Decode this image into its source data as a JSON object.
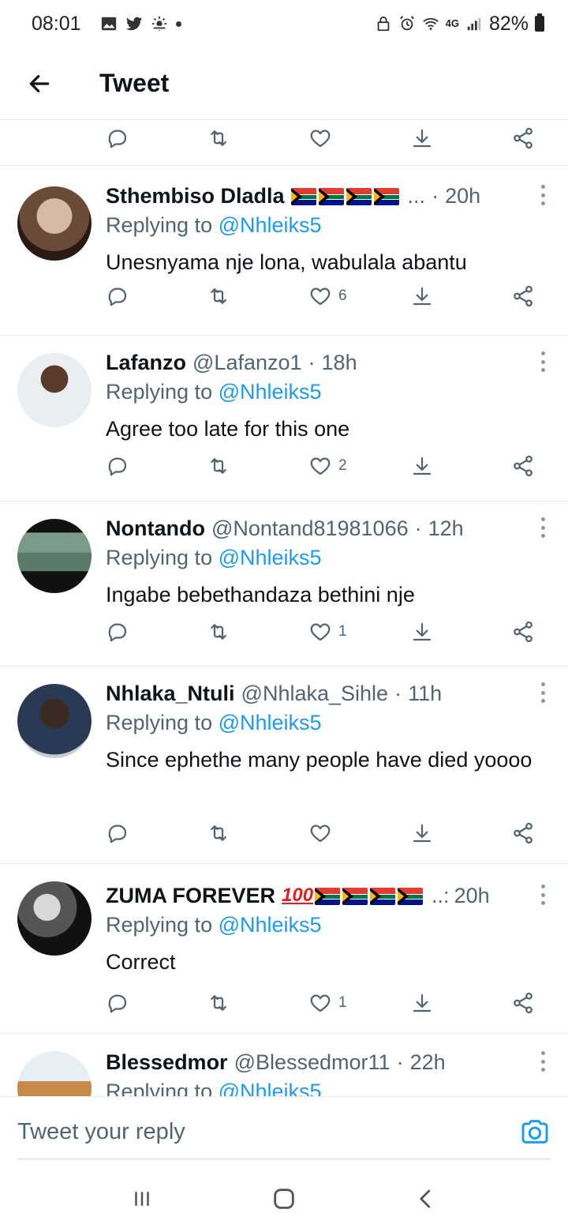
{
  "status_bar": {
    "time": "08:01",
    "network": "4G",
    "battery": "82%"
  },
  "header": {
    "title": "Tweet"
  },
  "tweets": [
    {
      "name": "Sthembiso Dladla",
      "handle": "",
      "suffix": "...",
      "time": "20h",
      "reply_label": "Replying to",
      "reply_to": "@Nhleiks5",
      "text": "Unesnyama nje lona, wabulala abantu",
      "likes": "6"
    },
    {
      "name": "Lafanzo",
      "handle": "@Lafanzo1",
      "time": "18h",
      "reply_label": "Replying to",
      "reply_to": "@Nhleiks5",
      "text": "Agree too late for this one",
      "likes": "2"
    },
    {
      "name": "Nontando",
      "handle": "@Nontand81981066",
      "time": "12h",
      "reply_label": "Replying to",
      "reply_to": "@Nhleiks5",
      "text": "Ingabe bebethandaza bethini nje",
      "likes": "1"
    },
    {
      "name": "Nhlaka_Ntuli",
      "handle": "@Nhlaka_Sihle",
      "time": "11h",
      "reply_label": "Replying to",
      "reply_to": "@Nhleiks5",
      "text": "Since ephethe many people have died yoooo",
      "likes": ""
    },
    {
      "name": "ZUMA FOREVER",
      "emoji": "100",
      "suffix": "..:",
      "time": "20h",
      "reply_label": "Replying to",
      "reply_to": "@Nhleiks5",
      "text": "Correct",
      "likes": "1"
    },
    {
      "name": "Blessedmor",
      "handle": "@Blessedmor11",
      "time": "22h",
      "reply_label": "Replying to",
      "reply_to": "@Nhleiks5"
    }
  ],
  "compose": {
    "placeholder": "Tweet your reply"
  },
  "icons": {
    "reply": "reply-icon",
    "retweet": "retweet-icon",
    "like": "heart-icon",
    "bookmark": "download-icon",
    "share": "share-icon"
  },
  "colors": {
    "accent": "#1d9bf0",
    "text": "#0f1419",
    "muted": "#536471"
  }
}
